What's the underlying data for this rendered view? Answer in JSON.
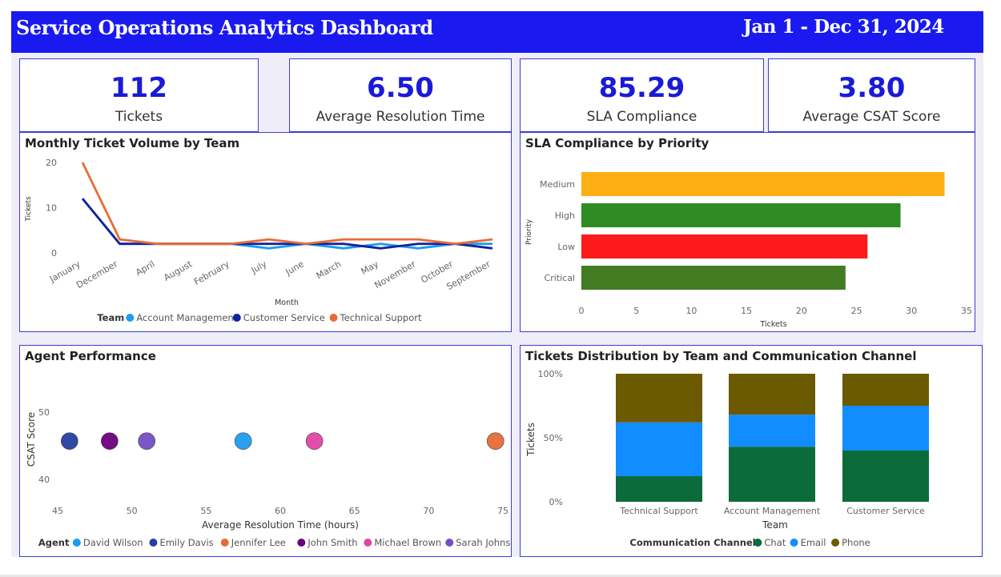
{
  "header": {
    "title": "Service Operations Analytics Dashboard",
    "date_range": "Jan 1 - Dec 31, 2024"
  },
  "kpis": [
    {
      "value": "112",
      "label": "Tickets"
    },
    {
      "value": "6.50",
      "label": "Average Resolution Time"
    },
    {
      "value": "85.29",
      "label": "SLA Compliance"
    },
    {
      "value": "3.80",
      "label": "Average CSAT Score"
    }
  ],
  "panels": {
    "line_title": "Monthly Ticket Volume by Team",
    "bar_title": "SLA Compliance by Priority",
    "scatter_title": "Agent Performance",
    "stacked_title": "Tickets Distribution by Team and Communication Channel"
  },
  "colors": {
    "accent": "#1a1af0",
    "account_management": "#1f9bf0",
    "customer_service": "#12239e",
    "technical_support": "#e66c37"
  },
  "chart_data": [
    {
      "type": "line",
      "title": "Monthly Ticket Volume by Team",
      "xlabel": "Month",
      "ylabel": "Tickets",
      "legend_title": "Team",
      "legend_position": "bottom",
      "categories": [
        "January",
        "December",
        "April",
        "August",
        "February",
        "July",
        "June",
        "March",
        "May",
        "November",
        "October",
        "September"
      ],
      "y_ticks": [
        "0",
        "10",
        "20"
      ],
      "ylim": [
        0,
        20
      ],
      "series": [
        {
          "name": "Account Management",
          "color": "#1f9bf0",
          "values": [
            12,
            2,
            2,
            2,
            2,
            1,
            2,
            1,
            2,
            1,
            2,
            2
          ]
        },
        {
          "name": "Customer Service",
          "color": "#12239e",
          "values": [
            12,
            2,
            2,
            2,
            2,
            2,
            2,
            2,
            1,
            2,
            2,
            1
          ]
        },
        {
          "name": "Technical Support",
          "color": "#e66c37",
          "values": [
            20,
            3,
            2,
            2,
            2,
            3,
            2,
            3,
            3,
            3,
            2,
            3
          ]
        }
      ]
    },
    {
      "type": "bar",
      "orientation": "horizontal",
      "title": "SLA Compliance by Priority",
      "xlabel": "Tickets",
      "ylabel": "Priority",
      "categories": [
        "Medium",
        "High",
        "Low",
        "Critical"
      ],
      "values": [
        33,
        29,
        26,
        24
      ],
      "colors": [
        "#fdae13",
        "#2e8b24",
        "#fd1a1a",
        "#437b22"
      ],
      "x_ticks": [
        "0",
        "5",
        "10",
        "15",
        "20",
        "25",
        "30",
        "35"
      ],
      "xlim": [
        0,
        35
      ]
    },
    {
      "type": "scatter",
      "title": "Agent Performance",
      "xlabel": "Average Resolution Time (hours)",
      "ylabel": "CSAT Score",
      "legend_title": "Agent",
      "legend_position": "bottom",
      "x_ticks": [
        "45",
        "50",
        "55",
        "60",
        "65",
        "70",
        "75"
      ],
      "y_ticks": [
        "40",
        "50"
      ],
      "xlim": [
        45,
        75
      ],
      "ylim": [
        37,
        53
      ],
      "points": [
        {
          "name": "David Wilson",
          "x": 57.5,
          "y": 45.7,
          "color": "#1f9bf0"
        },
        {
          "name": "Emily Davis",
          "x": 45.8,
          "y": 45.7,
          "color": "#253fa0"
        },
        {
          "name": "Jennifer Lee",
          "x": 74.5,
          "y": 45.7,
          "color": "#e66c37"
        },
        {
          "name": "John Smith",
          "x": 48.5,
          "y": 45.7,
          "color": "#6b007b"
        },
        {
          "name": "Michael Brown",
          "x": 62.3,
          "y": 45.7,
          "color": "#e044a7"
        },
        {
          "name": "Sarah Johnson",
          "x": 51.0,
          "y": 45.7,
          "color": "#744ec2"
        }
      ]
    },
    {
      "type": "bar",
      "stacked": "100%",
      "title": "Tickets Distribution by Team and Communication Channel",
      "xlabel": "Team",
      "ylabel": "Tickets",
      "legend_title": "Communication Channel",
      "legend_position": "bottom",
      "categories": [
        "Technical Support",
        "Account Management",
        "Customer Service"
      ],
      "y_ticks": [
        "0%",
        "50%",
        "100%"
      ],
      "series": [
        {
          "name": "Chat",
          "color": "#0b6b3a",
          "values": [
            20,
            43,
            40
          ]
        },
        {
          "name": "Email",
          "color": "#118dff",
          "values": [
            42,
            25,
            35
          ]
        },
        {
          "name": "Phone",
          "color": "#6b5a00",
          "values": [
            38,
            32,
            25
          ]
        }
      ]
    }
  ]
}
